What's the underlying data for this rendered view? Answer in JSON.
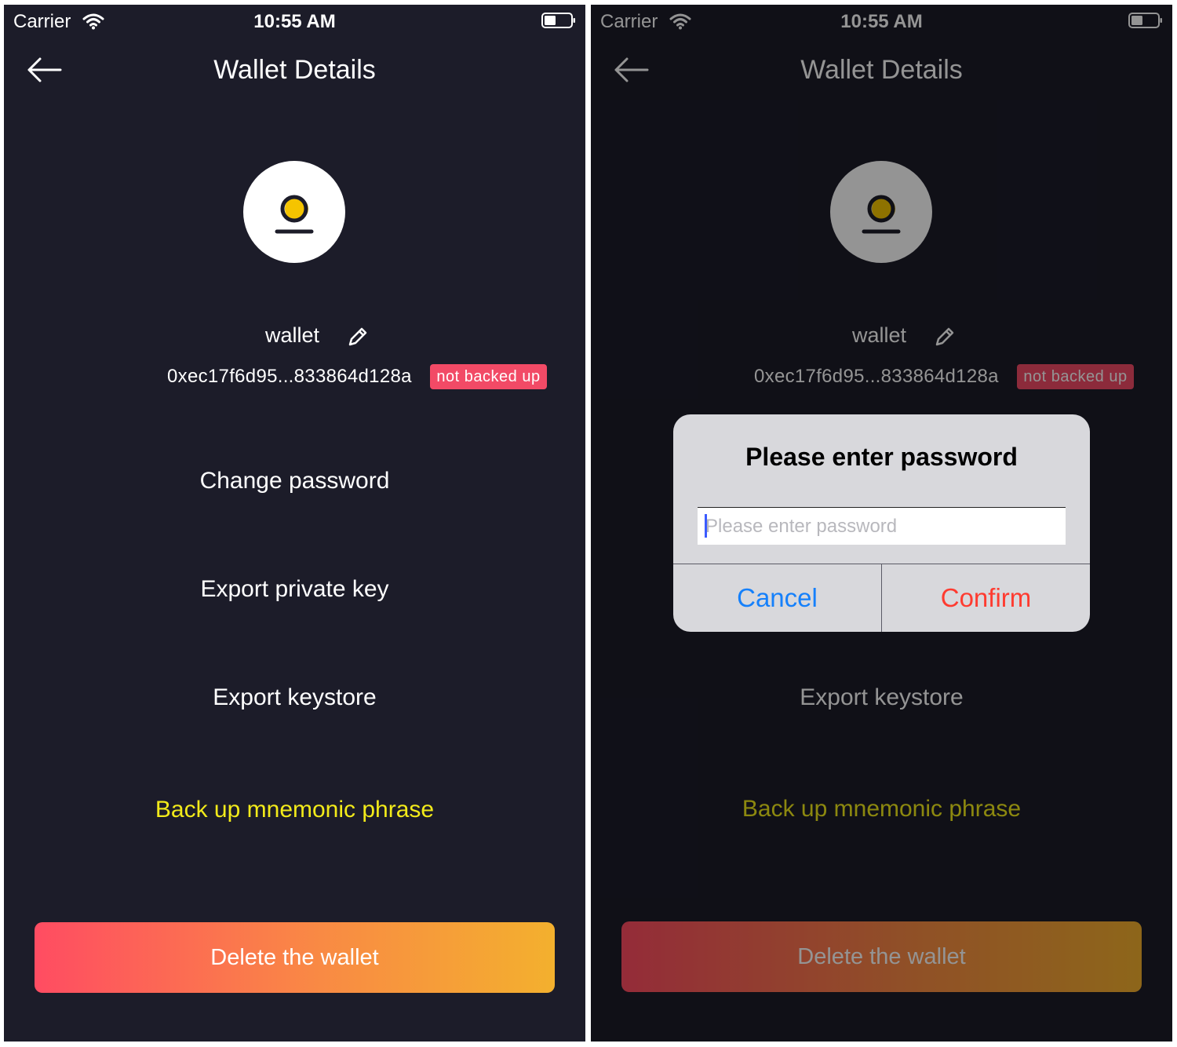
{
  "colors": {
    "background": "#1c1c29",
    "badge": "#f24a66",
    "accent_yellow": "#f2ea1a",
    "gradient_start": "#ff4c62",
    "gradient_end": "#f3b02e",
    "cancel_blue": "#1580fb",
    "confirm_red": "#ff3b30"
  },
  "screens": [
    {
      "status_bar": {
        "carrier": "Carrier",
        "time": "10:55 AM",
        "icons": [
          "wifi-icon",
          "battery-icon"
        ]
      },
      "nav": {
        "back_icon": "back-arrow-icon",
        "title": "Wallet Details"
      },
      "wallet": {
        "avatar_icon": "wallet-logo-icon",
        "name": "wallet",
        "edit_icon": "pencil-icon",
        "address": "0xec17f6d95...833864d128a",
        "badge": "not backed up"
      },
      "menu": [
        {
          "label": "Change password"
        },
        {
          "label": "Export private key"
        },
        {
          "label": "Export keystore"
        },
        {
          "label": "Back up mnemonic phrase"
        }
      ],
      "delete_button": "Delete the wallet"
    },
    {
      "status_bar": {
        "carrier": "Carrier",
        "time": "10:55 AM",
        "icons": [
          "wifi-icon",
          "battery-icon"
        ]
      },
      "nav": {
        "back_icon": "back-arrow-icon",
        "title": "Wallet Details"
      },
      "wallet": {
        "avatar_icon": "wallet-logo-icon",
        "name": "wallet",
        "edit_icon": "pencil-icon",
        "address": "0xec17f6d95...833864d128a",
        "badge": "not backed up"
      },
      "menu": [
        {
          "label": "Export keystore"
        },
        {
          "label": "Back up mnemonic phrase"
        }
      ],
      "delete_button": "Delete the wallet",
      "dialog": {
        "title": "Please enter password",
        "input_placeholder": "Please enter password",
        "input_value": "",
        "cancel_label": "Cancel",
        "confirm_label": "Confirm"
      }
    }
  ]
}
